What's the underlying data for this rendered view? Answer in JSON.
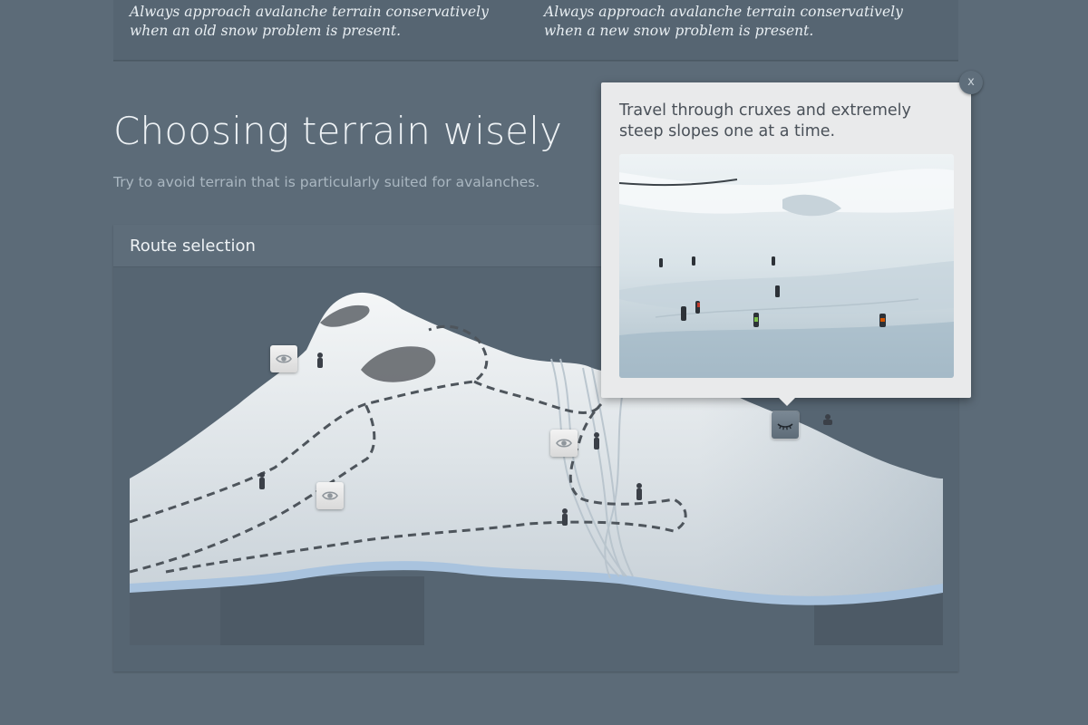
{
  "tips": {
    "left": "Always approach avalanche terrain conservatively when an old snow problem is present.",
    "right": "Always approach avalanche terrain conservatively when a new snow problem is present."
  },
  "section": {
    "title": "Choosing terrain wisely",
    "subtitle": "Try to avoid terrain that is particularly suited for avalanches."
  },
  "panel": {
    "title": "Route selection",
    "hotspots": [
      {
        "icon": "eye-icon",
        "state": "closed"
      },
      {
        "icon": "eye-icon",
        "state": "closed"
      },
      {
        "icon": "eye-icon",
        "state": "closed"
      },
      {
        "icon": "closed-eye-icon",
        "state": "open"
      }
    ]
  },
  "popup": {
    "text": "Travel through cruxes and extremely steep slopes one at a time.",
    "close_label": "x"
  }
}
